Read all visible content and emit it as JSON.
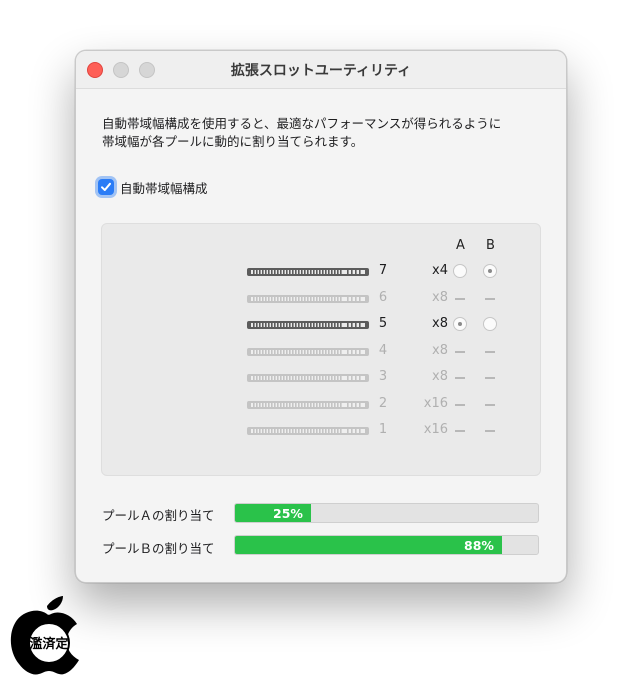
{
  "window": {
    "title": "拡張スロットユーティリティ"
  },
  "description": {
    "line1": "自動帯域幅構成を使用すると、最適なパフォーマンスが得られるように",
    "line2": "帯域幅が各プールに動的に割り当てられます。"
  },
  "auto_bandwidth": {
    "label": "自動帯域幅構成",
    "checked": true
  },
  "slots_panel": {
    "col_a": "A",
    "col_b": "B",
    "slots": [
      {
        "number": "7",
        "lanes": "x4",
        "active": true,
        "pool": "B"
      },
      {
        "number": "6",
        "lanes": "x8",
        "active": false,
        "pool": ""
      },
      {
        "number": "5",
        "lanes": "x8",
        "active": true,
        "pool": "A"
      },
      {
        "number": "4",
        "lanes": "x8",
        "active": false,
        "pool": ""
      },
      {
        "number": "3",
        "lanes": "x8",
        "active": false,
        "pool": ""
      },
      {
        "number": "2",
        "lanes": "x16",
        "active": false,
        "pool": ""
      },
      {
        "number": "1",
        "lanes": "x16",
        "active": false,
        "pool": ""
      }
    ]
  },
  "pools": [
    {
      "label": "プールＡの割り当て",
      "percent_text": "25%",
      "value": 0.25
    },
    {
      "label": "プールＢの割り当て",
      "percent_text": "88%",
      "value": 0.88
    }
  ],
  "badge": {
    "text": "濫済定"
  },
  "colors": {
    "accent": "#2a7cf6",
    "progress_fill": "#2ac24a",
    "close_button": "#fe5f57"
  }
}
